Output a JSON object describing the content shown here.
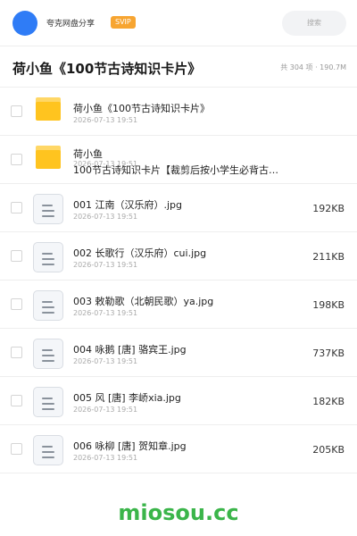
{
  "header": {
    "share_name": "夸克网盘分享",
    "badge": "SVIP",
    "search_placeholder": "搜索"
  },
  "title_row": {
    "title": "荷小鱼《100节古诗知识卡片》",
    "summary": "共 304 项 · 190.7M"
  },
  "items": [
    {
      "type": "folder",
      "name": "荷小鱼《100节古诗知识卡片》",
      "date": "2026-07-13 19:51",
      "size": ""
    },
    {
      "type": "folder",
      "name": "荷小鱼",
      "subname": "100节古诗知识卡片【裁剪后按小学生必背古…",
      "date": "2026-07-13 19:51",
      "size": ""
    },
    {
      "type": "file",
      "name": "001 江南（汉乐府）.jpg",
      "date": "2026-07-13 19:51",
      "size": "192KB"
    },
    {
      "type": "file",
      "name": "002 长歌行（汉乐府）cui.jpg",
      "date": "2026-07-13 19:51",
      "size": "211KB"
    },
    {
      "type": "file",
      "name": "003 敕勒歌（北朝民歌）ya.jpg",
      "date": "2026-07-13 19:51",
      "size": "198KB"
    },
    {
      "type": "file",
      "name": "004 咏鹅 [唐] 骆宾王.jpg",
      "date": "2026-07-13 19:51",
      "size": "737KB"
    },
    {
      "type": "file",
      "name": "005 风 [唐] 李峤xia.jpg",
      "date": "2026-07-13 19:51",
      "size": "182KB"
    },
    {
      "type": "file",
      "name": "006 咏柳 [唐] 贺知章.jpg",
      "date": "2026-07-13 19:51",
      "size": "205KB"
    }
  ],
  "icons": {
    "avatar": "avatar",
    "folder": "folder-icon",
    "file": "file-icon"
  },
  "colors": {
    "accent_blue": "#2f7cf6",
    "svip_orange": "#f7a531",
    "folder_yellow": "#ffc41f",
    "watermark_green": "#3bb54a"
  },
  "watermark": "miosou.cc"
}
